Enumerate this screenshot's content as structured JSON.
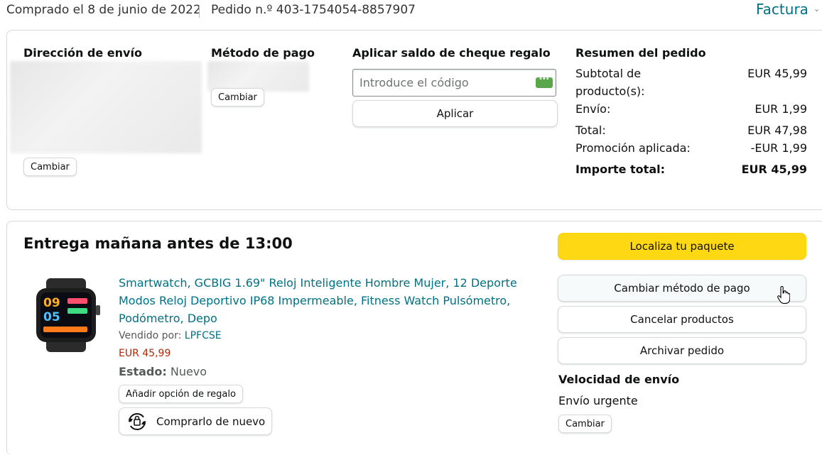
{
  "header": {
    "purchase_date": "Comprado el 8 de junio de 2022",
    "order_number": "Pedido n.º 403-1754054-8857907",
    "invoice_label": "Factura",
    "invoice_icon": "chevron-down-icon"
  },
  "shipping_address": {
    "heading": "Dirección de envío",
    "change_label": "Cambiar"
  },
  "payment_method": {
    "heading": "Método de pago",
    "change_label": "Cambiar"
  },
  "gift_card": {
    "heading": "Aplicar saldo de cheque regalo",
    "placeholder": "Introduce el código",
    "apply_label": "Aplicar",
    "card_icon": "gift-card-icon"
  },
  "order_summary": {
    "heading": "Resumen del pedido",
    "rows": [
      {
        "label": "Subtotal de",
        "label2": "producto(s):",
        "value": "EUR 45,99"
      },
      {
        "label": "Envío:",
        "value": "EUR 1,99"
      },
      {
        "label": "Total:",
        "value": "EUR 47,98"
      },
      {
        "label": "Promoción aplicada:",
        "value": "-EUR 1,99"
      },
      {
        "label": "Importe total:",
        "value": "EUR 45,99"
      }
    ]
  },
  "delivery": {
    "title": "Entrega mañana antes de 13:00",
    "product": {
      "title": "Smartwatch, GCBIG 1.69\" Reloj Inteligente Hombre Mujer, 12 Deporte Modos Reloj Deportivo IP68 Impermeable, Fitness Watch Pulsómetro, Podómetro, Depo",
      "sold_by_label": "Vendido por:",
      "seller": "LPFCSE",
      "price": "EUR 45,99",
      "status_label": "Estado:",
      "status_value": "Nuevo",
      "gift_option_label": "Añadir opción de regalo",
      "buy_again_label": "Comprarlo de nuevo",
      "buy_again_icon": "buy-again-icon",
      "watch_time_top": "09",
      "watch_time_bottom": "05"
    },
    "actions": {
      "track_label": "Localiza tu paquete",
      "change_payment_label": "Cambiar método de pago",
      "cancel_label": "Cancelar productos",
      "archive_label": "Archivar pedido"
    },
    "shipping_speed": {
      "heading": "Velocidad de envío",
      "value": "Envío urgente",
      "change_label": "Cambiar"
    }
  },
  "colors": {
    "link": "#007185",
    "primary_button": "#FFD814",
    "price": "#B12704",
    "border": "#D5D9D9"
  }
}
